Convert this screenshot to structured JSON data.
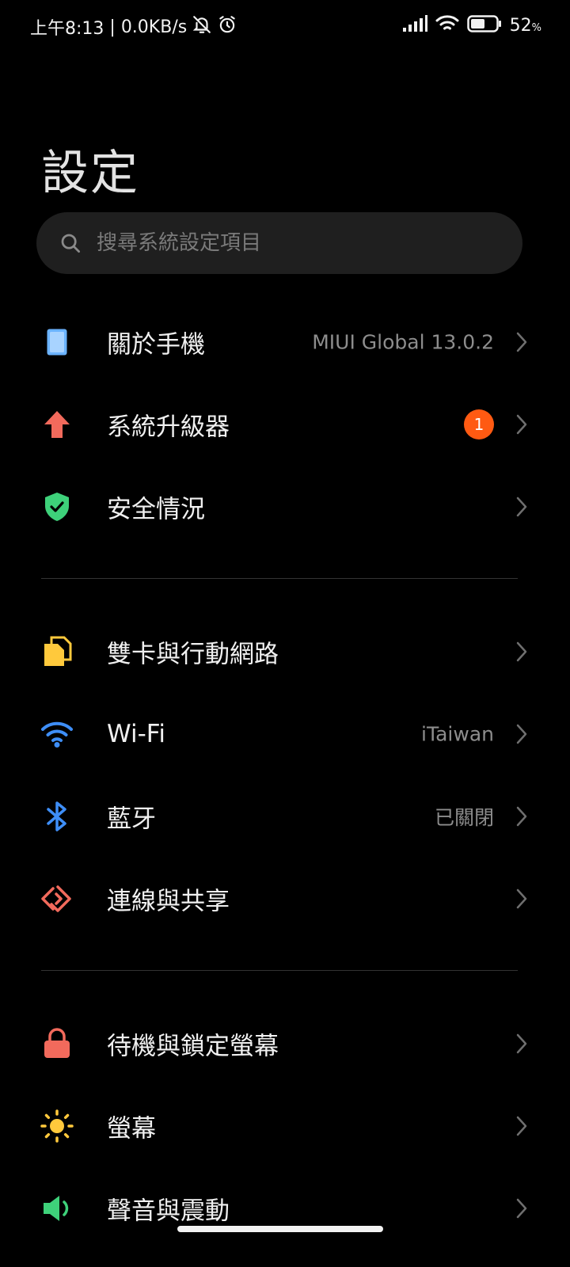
{
  "status_bar": {
    "time": "上午8:13",
    "net_speed": "0.0KB/s",
    "battery_percent": "52",
    "battery_unit": "%",
    "icons": [
      "bell-off-icon",
      "alarm-icon",
      "signal-icon",
      "wifi-icon",
      "battery-icon"
    ]
  },
  "page": {
    "title": "設定"
  },
  "search": {
    "placeholder": "搜尋系統設定項目"
  },
  "groups": [
    {
      "items": [
        {
          "label": "關於手機",
          "value": "MIUI Global 13.0.2",
          "icon": "phone-icon"
        },
        {
          "label": "系統升級器",
          "badge": "1",
          "icon": "update-arrow-icon"
        },
        {
          "label": "安全情況",
          "icon": "shield-check-icon"
        }
      ]
    },
    {
      "items": [
        {
          "label": "雙卡與行動網路",
          "icon": "sim-card-icon"
        },
        {
          "label": "Wi-Fi",
          "value": "iTaiwan",
          "icon": "wifi-icon"
        },
        {
          "label": "藍牙",
          "value": "已關閉",
          "icon": "bluetooth-icon"
        },
        {
          "label": "連線與共享",
          "icon": "connection-share-icon"
        }
      ]
    },
    {
      "items": [
        {
          "label": "待機與鎖定螢幕",
          "icon": "lock-icon"
        },
        {
          "label": "螢幕",
          "icon": "brightness-icon"
        },
        {
          "label": "聲音與震動",
          "icon": "speaker-icon"
        }
      ]
    }
  ],
  "colors": {
    "background": "#000000",
    "search_bg": "#1f1f1f",
    "badge": "#ff5a12",
    "phone_icon": "#6bb3ff",
    "update_icon": "#f26a5c",
    "shield_icon": "#3ed17a",
    "sim_icon": "#ffc93c",
    "wifi_icon": "#3e8ef7",
    "bluetooth_icon": "#3e8ef7",
    "share_icon": "#f26a5c",
    "lock_icon": "#f26a5c",
    "brightness_icon": "#ffc93c",
    "speaker_icon": "#3ed17a"
  }
}
